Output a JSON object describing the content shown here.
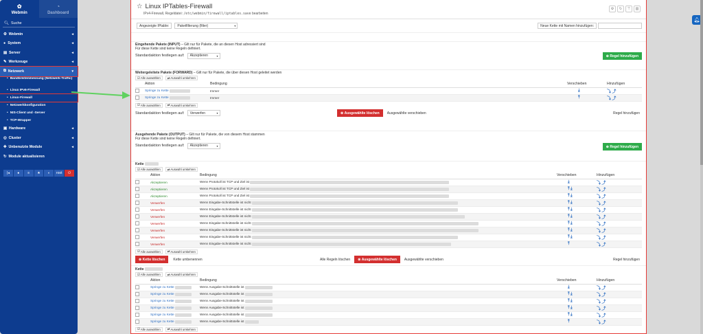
{
  "sidebar": {
    "tab_webmin": "Webmin",
    "tab_dashboard": "Dashboard",
    "search": "Suche",
    "items": [
      {
        "label": "Webmin"
      },
      {
        "label": "System"
      },
      {
        "label": "Server"
      },
      {
        "label": "Werkzeuge"
      },
      {
        "label": "Netzwerk"
      }
    ],
    "subitems": [
      "Bandbreitenmessung (Netzwerk-Traffic)",
      "Linux IPv6-Firewall",
      "Linux-Firewall",
      "Netzwerkkonfiguration",
      "NIS-Client und -Server",
      "TCP-Wrapper"
    ],
    "items2": [
      {
        "label": "Hardware"
      },
      {
        "label": "Cluster"
      },
      {
        "label": "Unbenutzte Module"
      },
      {
        "label": "Module aktualisieren"
      }
    ],
    "user": "root"
  },
  "header": {
    "title": "Linux IPTables-Firewall",
    "sub_prefix": "IPv4-Firewall, Regeldatei:",
    "file": "/etc/webmin/firewall/iptables.save",
    "sub_suffix": "bearbeiten"
  },
  "filter": {
    "label": "Angezeigte IPtable:",
    "value": "Paketfilterung (filter)",
    "new_chain": "Neue Kette mit Namen hinzufügen:"
  },
  "common": {
    "select_all": "Alle auswählen",
    "invert": "Auswahl umkehren",
    "standard": "Standardaktion festlegen auf:",
    "add_rule": "Regel hinzufügen",
    "col_action": "Aktion",
    "col_cond": "Bedingung",
    "col_move": "Verschieben",
    "col_add": "Hinzufügen",
    "del_sel": "Ausgewählte löschen",
    "move_sel": "Ausgewählte verschieben",
    "no_rules": "Für diese Kette sind keine Regeln definiert."
  },
  "input": {
    "title": "Eingehende Pakete (INPUT)",
    "desc": "– Gilt nur für Pakete, die an diesen Host adressiert sind",
    "std": "Akzeptieren"
  },
  "forward": {
    "title": "Weitergeleitete Pakete (FORWARD)",
    "desc": "– Gilt nur für Pakete, die über diesen Host geleitet werden",
    "std": "Verwerfen",
    "rows": [
      {
        "action": "Springe zu Kette",
        "cond": "Immer"
      },
      {
        "action": "Springe zu Kette",
        "cond": "Immer"
      }
    ]
  },
  "output": {
    "title": "Ausgehende Pakete (OUTPUT)",
    "desc": "– Gilt nur für Pakete, die von diesem Host stammen",
    "std": "Akzeptieren"
  },
  "chain1": {
    "title": "Kette",
    "rows": [
      {
        "action": "Akzeptieren",
        "cond": "Wenn Protokoll ist TCP und Ziel ist",
        "t": "acc"
      },
      {
        "action": "Akzeptieren",
        "cond": "Wenn Protokoll ist TCP und Ziel ist",
        "t": "acc"
      },
      {
        "action": "Akzeptieren",
        "cond": "Wenn Protokoll ist TCP und Ziel ist",
        "t": "acc"
      },
      {
        "action": "Verwerfen",
        "cond": "Wenn Eingabe-Schnittstelle ist nicht",
        "t": "rej"
      },
      {
        "action": "Verwerfen",
        "cond": "Wenn Eingabe-Schnittstelle ist nicht",
        "t": "rej"
      },
      {
        "action": "Verwerfen",
        "cond": "Wenn Eingabe-Schnittstelle ist nicht",
        "t": "rej"
      },
      {
        "action": "Verwerfen",
        "cond": "Wenn Eingabe-Schnittstelle ist nicht",
        "t": "rej"
      },
      {
        "action": "Verwerfen",
        "cond": "Wenn Eingabe-Schnittstelle ist nicht",
        "t": "rej"
      },
      {
        "action": "Verwerfen",
        "cond": "Wenn Eingabe-Schnittstelle ist nicht",
        "t": "rej"
      },
      {
        "action": "Verwerfen",
        "cond": "Wenn Eingabe-Schnittstelle ist nicht",
        "t": "rej"
      }
    ],
    "del_chain": "Kette löschen",
    "rename": "Kette umbenennen",
    "del_all": "Alle Regeln löschen"
  },
  "chain2": {
    "title": "Kette",
    "rows": [
      {
        "action": "Springe zu Kette",
        "cond": "Wenn Ausgabe-Schnittstelle ist"
      },
      {
        "action": "Springe zu Kette",
        "cond": "Wenn Ausgabe-Schnittstelle ist"
      },
      {
        "action": "Springe zu Kette",
        "cond": "Wenn Ausgabe-Schnittstelle ist"
      },
      {
        "action": "Springe zu Kette",
        "cond": "Wenn Ausgabe-Schnittstelle ist"
      },
      {
        "action": "Springe zu Kette",
        "cond": "Wenn Ausgabe-Schnittstelle ist"
      },
      {
        "action": "Springe zu Kette",
        "cond": "Wenn Ausgabe-Schnittstelle ist"
      }
    ]
  }
}
